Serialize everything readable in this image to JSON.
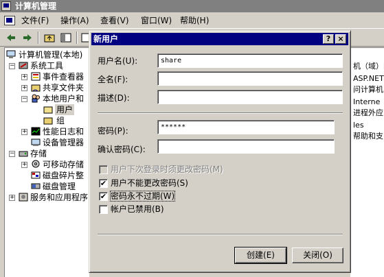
{
  "window": {
    "title": "计算机管理"
  },
  "menu": [
    {
      "label": "文件(F)"
    },
    {
      "label": "操作(A)"
    },
    {
      "label": "查看(V)"
    },
    {
      "label": "窗口(W)"
    },
    {
      "label": "帮助(H)"
    }
  ],
  "tree": [
    {
      "label": "计算机管理(本地)"
    },
    {
      "label": "系统工具"
    },
    {
      "label": "事件查看器"
    },
    {
      "label": "共享文件夹"
    },
    {
      "label": "本地用户和"
    },
    {
      "label": "用户"
    },
    {
      "label": "组"
    },
    {
      "label": "性能日志和"
    },
    {
      "label": "设备管理器"
    },
    {
      "label": "存储"
    },
    {
      "label": "可移动存储"
    },
    {
      "label": "磁盘碎片整"
    },
    {
      "label": "磁盘管理"
    },
    {
      "label": "服务和应用程序"
    }
  ],
  "right_pane": [
    "机（域）的",
    "ASP.NET",
    "问计算机",
    "Interne",
    "进程外应",
    "les",
    "帮助和支"
  ],
  "dialog": {
    "title": "新用户",
    "help_btn": "?",
    "close_btn": "×",
    "username_label": "用户名(U):",
    "username_value": "share",
    "fullname_label": "全名(F):",
    "fullname_value": "",
    "description_label": "描述(D):",
    "description_value": "",
    "password_label": "密码(P):",
    "password_value": "******",
    "confirm_label": "确认密码(C):",
    "confirm_value": "",
    "options": [
      {
        "label": "用户下次登录时须更改密码(M)",
        "checked": false,
        "disabled": true,
        "mark": ""
      },
      {
        "label": "用户不能更改密码(S)",
        "checked": true,
        "disabled": false,
        "mark": "✔"
      },
      {
        "label": "密码永不过期(W)",
        "checked": true,
        "disabled": false,
        "mark": "✔"
      },
      {
        "label": "帐户已禁用(B)",
        "checked": false,
        "disabled": false,
        "mark": ""
      }
    ],
    "create_btn": "创建(E)",
    "close_btn_label": "关闭(O)"
  }
}
